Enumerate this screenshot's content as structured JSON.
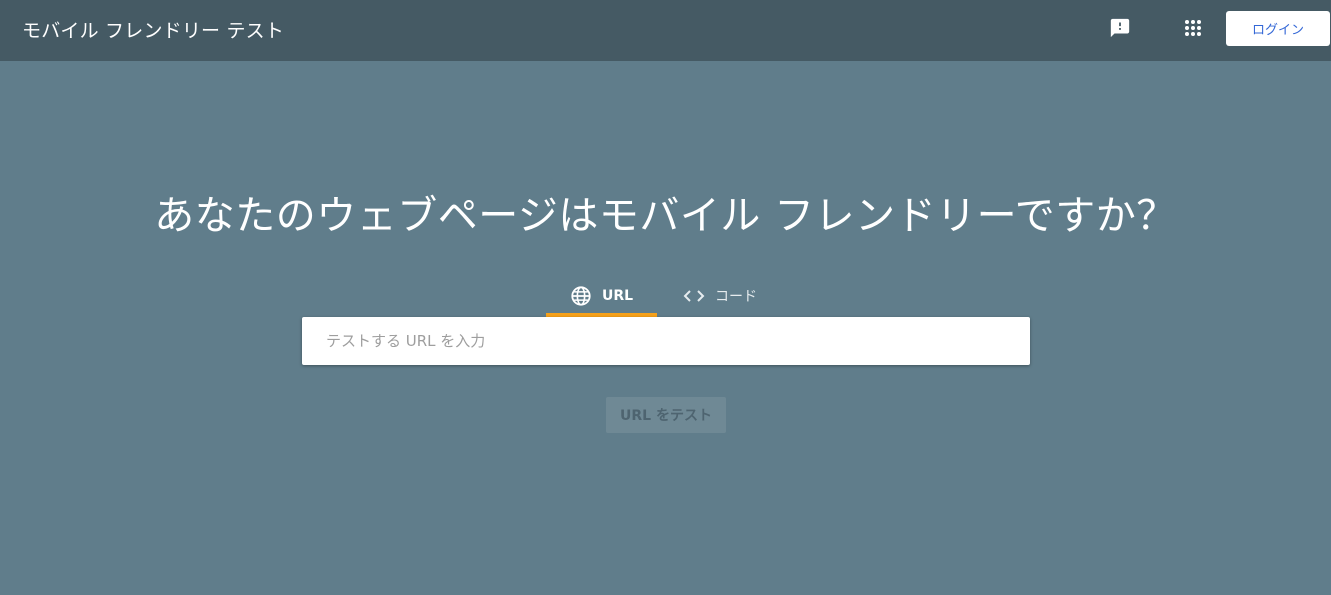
{
  "header": {
    "app_title": "モバイル フレンドリー テスト",
    "feedback_icon": "feedback-icon",
    "apps_icon": "apps-grid-icon",
    "login_label": "ログイン"
  },
  "main": {
    "headline": "あなたのウェブページはモバイル フレンドリーですか？",
    "tabs": [
      {
        "label": "URL",
        "icon": "globe-icon",
        "selected": true
      },
      {
        "label": "コード",
        "icon": "code-icon",
        "selected": false
      }
    ],
    "url_input": {
      "value": "",
      "placeholder": "テストする URL を入力"
    },
    "test_button_label": "URL をテスト",
    "test_button_disabled": true
  },
  "colors": {
    "background": "#607d8b",
    "header": "#455a64",
    "tab_indicator": "#f6a11a",
    "login_text": "#3367d6"
  }
}
